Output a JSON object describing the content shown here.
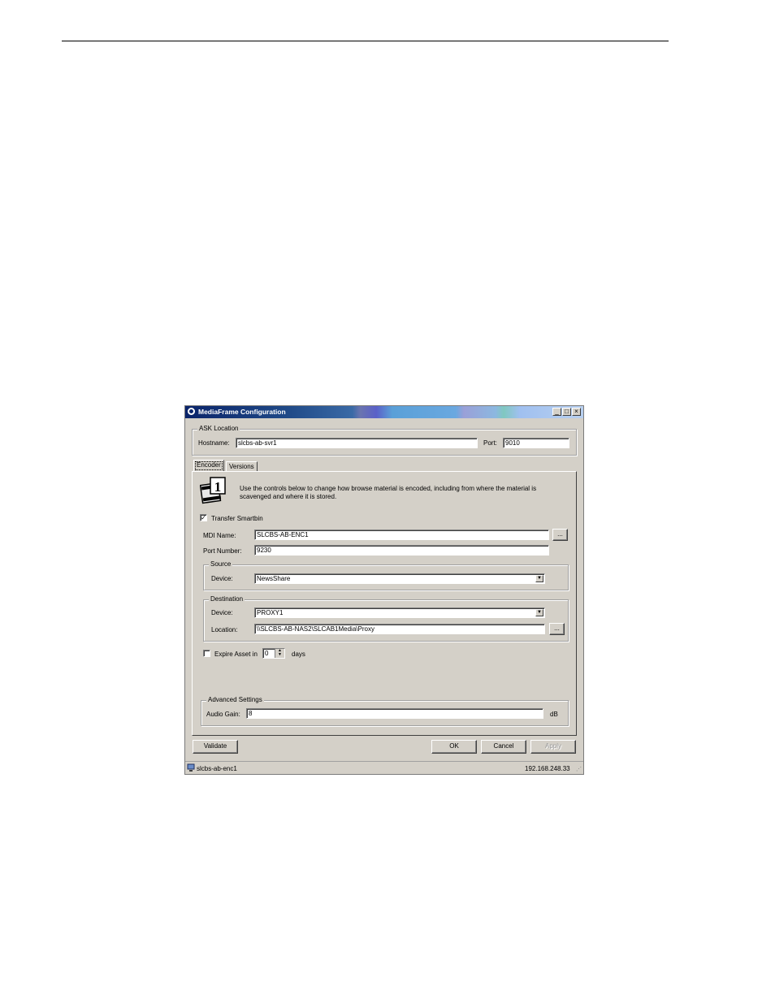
{
  "window": {
    "title": "MediaFrame Configuration"
  },
  "window_buttons": {
    "minimize": "_",
    "maximize": "□",
    "close": "×"
  },
  "ask_location": {
    "legend": "ASK Location",
    "hostname_label": "Hostname:",
    "hostname_value": "slcbs-ab-svr1",
    "port_label": "Port:",
    "port_value": "9010"
  },
  "tabs": [
    {
      "label": "Encoder"
    },
    {
      "label": "Versions"
    }
  ],
  "encoder": {
    "description": "Use the controls below to change how browse material is encoded, including from where the material is scavenged and where it is stored.",
    "transfer_smartbin_label": "Transfer Smartbin",
    "transfer_smartbin_checked": true,
    "check_mark": "✓",
    "mdi_name_label": "MDI Name:",
    "mdi_name_value": "SLCBS-AB-ENC1",
    "port_number_label": "Port Number:",
    "port_number_value": "9230",
    "browse_label": "...",
    "source": {
      "legend": "Source",
      "device_label": "Device:",
      "device_value": "NewsShare"
    },
    "destination": {
      "legend": "Destination",
      "device_label": "Device:",
      "device_value": "PROXY1",
      "location_label": "Location:",
      "location_value": "\\\\SLCBS-AB-NAS2\\SLCAB1Media\\Proxy"
    },
    "expire_label": "Expire Asset in",
    "expire_checked": false,
    "expire_value": "0",
    "days_label": "days",
    "advanced": {
      "legend": "Advanced Settings",
      "audio_gain_label": "Audio Gain:",
      "audio_gain_value": "8",
      "db_label": "dB"
    }
  },
  "buttons": {
    "validate": "Validate",
    "ok": "OK",
    "cancel": "Cancel",
    "apply": "Apply"
  },
  "status": {
    "host": "slcbs-ab-enc1",
    "ip": "192.168.248.33"
  }
}
